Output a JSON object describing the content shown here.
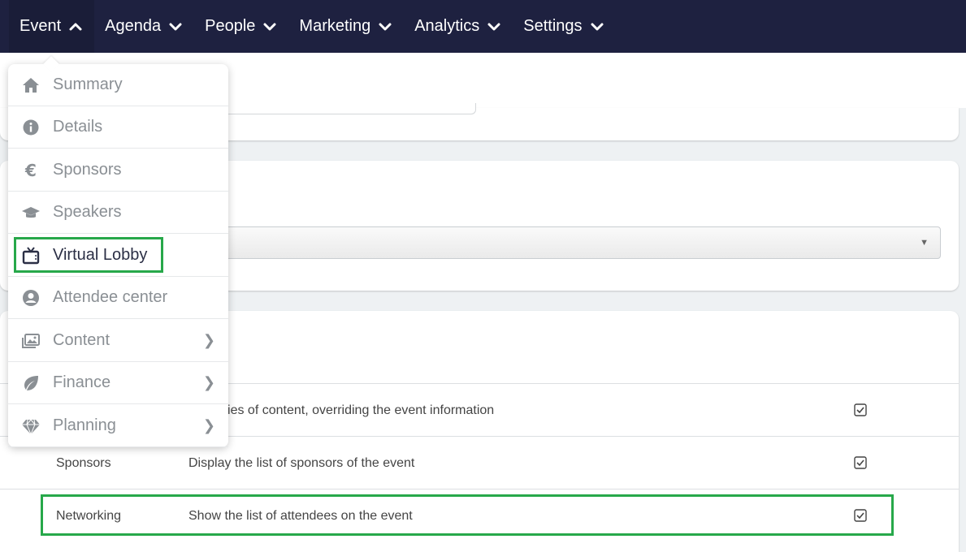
{
  "nav": {
    "items": [
      {
        "label": "Event",
        "chevron": "up"
      },
      {
        "label": "Agenda",
        "chevron": "down"
      },
      {
        "label": "People",
        "chevron": "down"
      },
      {
        "label": "Marketing",
        "chevron": "down"
      },
      {
        "label": "Analytics",
        "chevron": "down"
      },
      {
        "label": "Settings",
        "chevron": "down"
      }
    ],
    "background": "#1e2140"
  },
  "event_menu": {
    "items": [
      {
        "label": "Summary",
        "icon": "home-icon"
      },
      {
        "label": "Details",
        "icon": "info-circle-icon"
      },
      {
        "label": "Sponsors",
        "icon": "euro-icon"
      },
      {
        "label": "Speakers",
        "icon": "graduation-cap-icon"
      },
      {
        "label": "Virtual Lobby",
        "icon": "tv-icon",
        "highlighted": true
      },
      {
        "label": "Attendee center",
        "icon": "user-circle-icon"
      },
      {
        "label": "Content",
        "icon": "images-icon",
        "submenu": true
      },
      {
        "label": "Finance",
        "icon": "leaf-icon",
        "submenu": true
      },
      {
        "label": "Planning",
        "icon": "gem-icon",
        "submenu": true
      }
    ],
    "submenu_arrow": "❯"
  },
  "lobby_table": {
    "rows": [
      {
        "name": "",
        "description": "y a series of content, overriding the event information",
        "checked": true
      },
      {
        "name": "Sponsors",
        "description": "Display the list of sponsors of the event",
        "checked": true
      },
      {
        "name": "Networking",
        "description": "Show the list of attendees on the event",
        "checked": true,
        "highlighted": true
      }
    ]
  },
  "select": {
    "arrow": "▼"
  },
  "colors": {
    "highlight": "#27a84a",
    "nav_bg": "#1e2140"
  }
}
